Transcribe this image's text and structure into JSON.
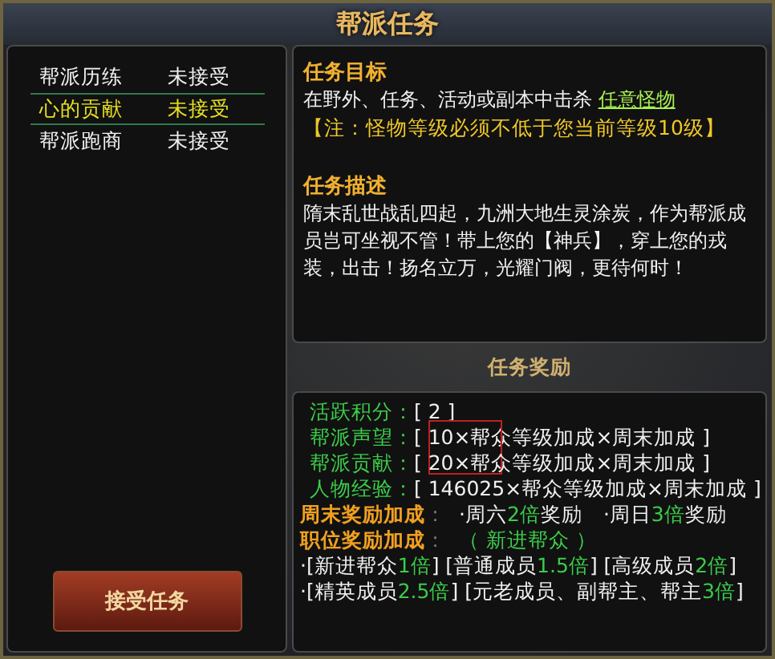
{
  "window": {
    "title": "帮派任务"
  },
  "quests": [
    {
      "name": "帮派历练",
      "status": "未接受",
      "selected": false
    },
    {
      "name": "心的贡献",
      "status": "未接受",
      "selected": true
    },
    {
      "name": "帮派跑商",
      "status": "未接受",
      "selected": false
    }
  ],
  "accept_button": "接受任务",
  "objective": {
    "heading": "任务目标",
    "text": "在野外、任务、活动或副本中击杀",
    "target_link": "任意怪物",
    "note": "【注：怪物等级必须不低于您当前等级10级】"
  },
  "description": {
    "heading": "任务描述",
    "text": "隋末乱世战乱四起，九洲大地生灵涂炭，作为帮派成员岂可坐视不管！带上您的【神兵】，穿上您的戎装，出击！扬名立万，光耀门阀，更待何时！"
  },
  "rewards": {
    "heading": "任务奖励",
    "items": [
      {
        "label": "活跃积分：",
        "value": "[ 2 ]"
      },
      {
        "label": "帮派声望：",
        "value": "[ 10×帮众等级加成×周末加成 ]"
      },
      {
        "label": "帮派贡献：",
        "value": "[ 20×帮众等级加成×周末加成 ]"
      },
      {
        "label": "人物经验：",
        "value": "[ 146025×帮众等级加成×周末加成 ]"
      }
    ],
    "bonus_rows": [
      {
        "label": "周末奖励加成",
        "separator": "：",
        "segments": [
          {
            "text": "·周六",
            "accent": false
          },
          {
            "text": "2倍",
            "accent": true
          },
          {
            "text": "奖励",
            "accent": false
          },
          {
            "text": "　·周日",
            "accent": false
          },
          {
            "text": "3倍",
            "accent": true
          },
          {
            "text": "奖励",
            "accent": false
          }
        ]
      },
      {
        "label": "职位奖励加成",
        "separator": "：",
        "segments": [
          {
            "text": "（ 新进帮众 ）",
            "accent": true
          }
        ]
      }
    ],
    "multiplier_lines": [
      [
        {
          "text": "·[新进帮众",
          "accent": false
        },
        {
          "text": "1倍",
          "accent": true
        },
        {
          "text": "] [普通成员",
          "accent": false
        },
        {
          "text": "1.5倍",
          "accent": true
        },
        {
          "text": "] [高级成员",
          "accent": false
        },
        {
          "text": "2倍",
          "accent": true
        },
        {
          "text": "]",
          "accent": false
        }
      ],
      [
        {
          "text": "·[精英成员",
          "accent": false
        },
        {
          "text": "2.5倍",
          "accent": true
        },
        {
          "text": "] [元老成员、副帮主、帮主",
          "accent": false
        },
        {
          "text": "3倍",
          "accent": true
        },
        {
          "text": "]",
          "accent": false
        }
      ]
    ]
  }
}
